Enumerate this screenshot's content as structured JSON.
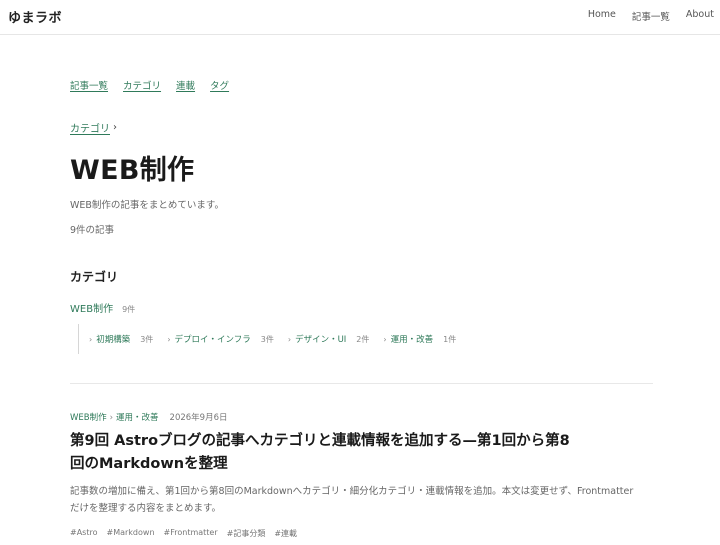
{
  "header": {
    "logo": "ゆまラボ",
    "nav": [
      "Home",
      "記事一覧",
      "About"
    ]
  },
  "subnav": [
    "記事一覧",
    "カテゴリ",
    "連載",
    "タグ"
  ],
  "breadcrumb": {
    "link": "カテゴリ",
    "separator": "›"
  },
  "page": {
    "title": "WEB制作",
    "description": "WEB制作の記事をまとめています。",
    "count": "9件の記事"
  },
  "categories": {
    "heading": "カテゴリ",
    "top": {
      "label": "WEB制作",
      "count": "9件"
    },
    "chevron": "›",
    "subs": [
      {
        "label": "初期構築",
        "count": "3件"
      },
      {
        "label": "デプロイ・インフラ",
        "count": "3件"
      },
      {
        "label": "デザイン・UI",
        "count": "2件"
      },
      {
        "label": "運用・改善",
        "count": "1件"
      }
    ]
  },
  "article": {
    "category": "WEB制作",
    "separator": "›",
    "subcategory": "運用・改善",
    "date": "2026年9月6日",
    "title": "第9回 Astroブログの記事へカテゴリと連載情報を追加する—第1回から第8回のMarkdownを整理",
    "excerpt": "記事数の増加に備え、第1回から第8回のMarkdownへカテゴリ・細分化カテゴリ・連載情報を追加。本文は変更せず、Frontmatterだけを整理する内容をまとめます。",
    "tags": [
      "#Astro",
      "#Markdown",
      "#Frontmatter",
      "#記事分類",
      "#連載"
    ]
  },
  "colors": {
    "accent": "#2f7a5a",
    "text": "#222222",
    "muted": "#666666"
  }
}
